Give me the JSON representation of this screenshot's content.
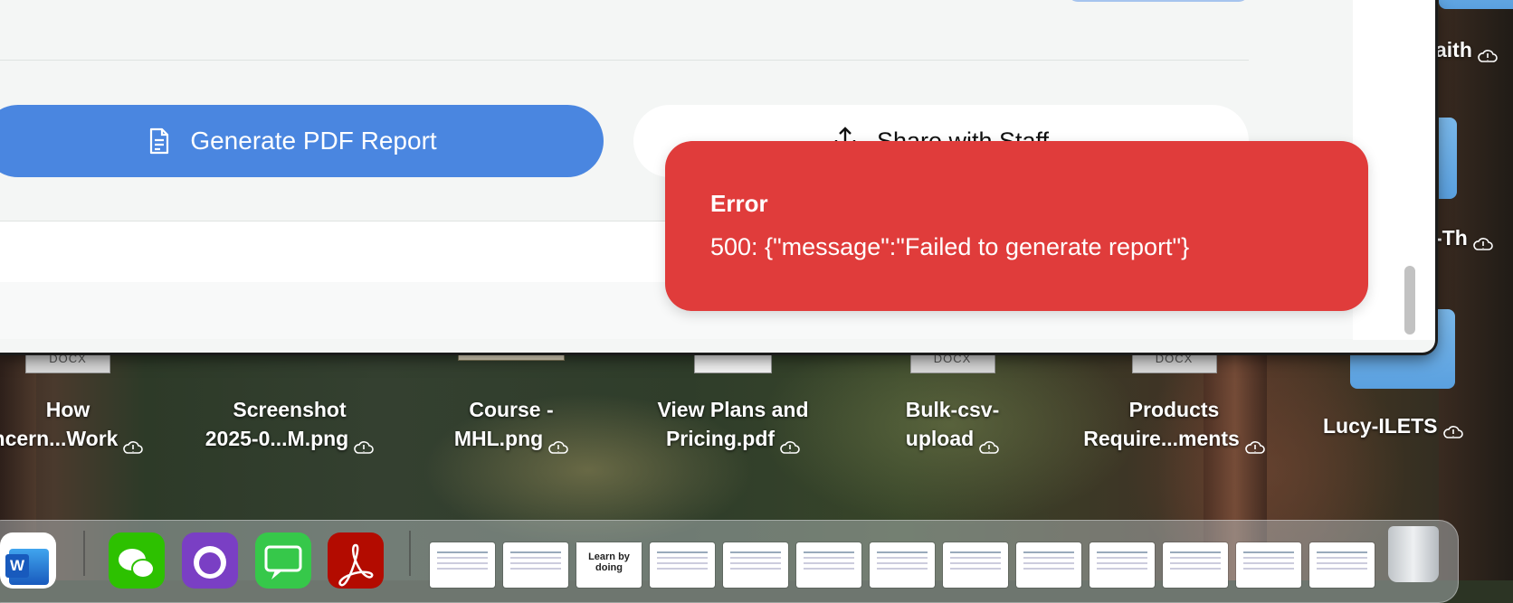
{
  "window": {
    "primary_button_label": "Generate PDF Report",
    "secondary_button_label": "Share with Staff"
  },
  "toast": {
    "title": "Error",
    "message": "500: {\"message\":\"Failed to generate report\"}"
  },
  "desktop": {
    "files": [
      {
        "line1": "How",
        "line2": "ncern...Work",
        "thumb": "DOCX"
      },
      {
        "line1": "Screenshot",
        "line2": "2025-0...M.png",
        "thumb": ""
      },
      {
        "line1": "Course -",
        "line2": "MHL.png",
        "thumb": ""
      },
      {
        "line1": "View Plans and",
        "line2": "Pricing.pdf",
        "thumb": ""
      },
      {
        "line1": "Bulk-csv-",
        "line2": "upload",
        "thumb": "DOCX"
      },
      {
        "line1": "Products",
        "line2": "Require...ments",
        "thumb": "DOCX"
      }
    ],
    "side_items": [
      {
        "label": "aith"
      },
      {
        "label": "-Th"
      },
      {
        "label": "Lucy-ILETS"
      }
    ]
  },
  "dock": {
    "apps": [
      "Microsoft Word",
      "WeChat",
      "GitHub Desktop",
      "Messages",
      "Adobe Acrobat"
    ],
    "doc_thumb_text": "Learn by doing",
    "trash": "Trash"
  },
  "colors": {
    "primary": "#4a86e0",
    "error": "#e03c3b"
  }
}
